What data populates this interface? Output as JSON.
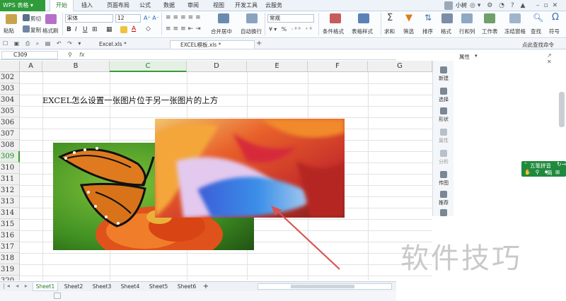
{
  "titlebar": {
    "app": "WPS 表格",
    "tabs": [
      "开始",
      "插入",
      "页面布局",
      "公式",
      "数据",
      "审阅",
      "视图",
      "开发工具",
      "云服务"
    ],
    "user": "小树"
  },
  "ribbon": {
    "paste": "粘贴",
    "cut": "剪切",
    "copy": "复制",
    "format_painter": "格式刷",
    "font": "宋体",
    "font_size": "12",
    "merge_center": "合并居中",
    "wrap_text": "自动换行",
    "number_format": "常规",
    "cond_format": "条件格式",
    "table_style": "表格样式",
    "sum": "求和",
    "filter": "筛选",
    "sort": "排序",
    "format": "格式",
    "row_col": "行和列",
    "worksheet": "工作表",
    "freeze": "冻结窗格",
    "find": "查找",
    "symbol": "符号"
  },
  "docbar": {
    "tabs": [
      "Excel.xls *",
      "EXCEL模板.xls *"
    ],
    "active": 1,
    "search_placeholder": "点此查找命令"
  },
  "formulabar": {
    "cell_ref": "C309",
    "fx": "fx"
  },
  "grid": {
    "columns": [
      "A",
      "B",
      "C",
      "D",
      "E",
      "F",
      "G"
    ],
    "selected_column": "C",
    "rows": [
      "302",
      "303",
      "304",
      "305",
      "306",
      "307",
      "308",
      "309",
      "310",
      "311",
      "312",
      "313",
      "314",
      "315",
      "316",
      "317",
      "318",
      "319",
      "320"
    ],
    "selected_row": "309",
    "cell_text": "EXCEL怎么设置一张图片位于另一张图片的上方"
  },
  "sheets": {
    "tabs": [
      "Sheet1",
      "Sheet2",
      "Sheet3",
      "Sheet4",
      "Sheet5",
      "Sheet6"
    ],
    "active": 0,
    "add": "+"
  },
  "sidebar": {
    "items": [
      "新建",
      "选择",
      "形状",
      "属性",
      "分析",
      "传图",
      "推荐"
    ]
  },
  "properties": {
    "title": "属性"
  },
  "ime": {
    "label": "五笔拼音",
    "chars": [
      "简",
      "⊞"
    ]
  },
  "watermark": "软件技巧",
  "colors": {
    "accent_green": "#2f9b3a",
    "selection_green": "#3a9a3a",
    "arrow_red": "#d9534f",
    "ime_green": "#1f8a3d"
  },
  "icons": [
    "paste-icon",
    "cut-icon",
    "copy-icon",
    "format-painter-icon",
    "bold-icon",
    "italic-icon",
    "underline-icon",
    "fill-color-icon",
    "font-color-icon",
    "sum-icon",
    "filter-icon",
    "sort-icon",
    "find-icon",
    "symbol-icon"
  ]
}
